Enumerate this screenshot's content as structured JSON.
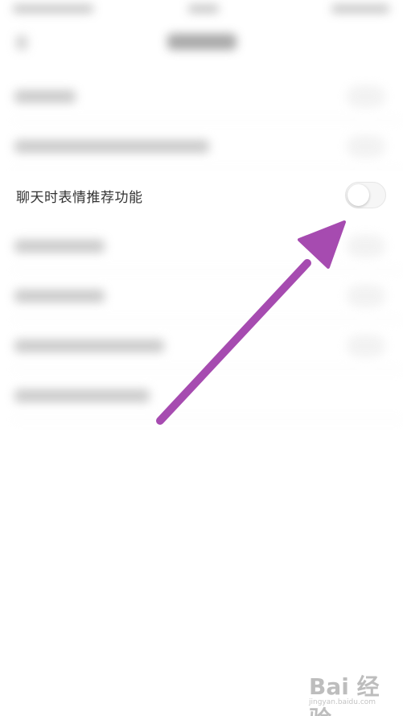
{
  "settings": {
    "emoji_recommend": {
      "label": "聊天时表情推荐功能",
      "enabled": false
    }
  },
  "annotation": {
    "arrow_color": "#a64bb0"
  },
  "watermark": {
    "logo_text": "Bai 经验",
    "sub_text": "jingyan.baidu.com"
  }
}
